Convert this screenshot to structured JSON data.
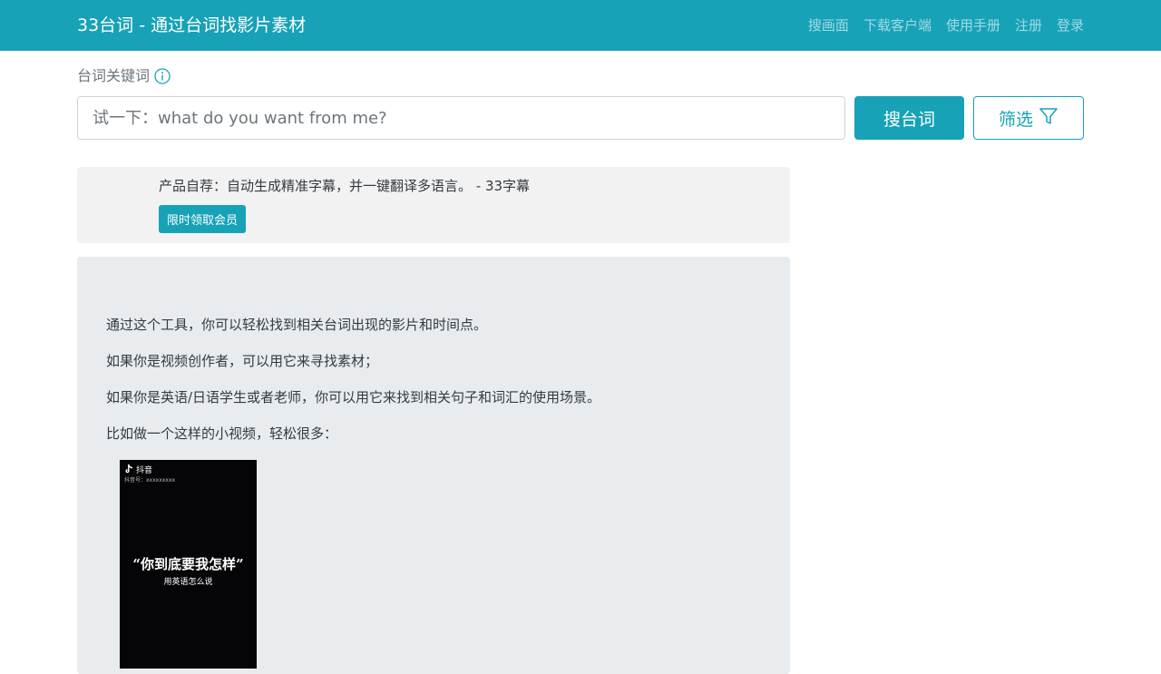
{
  "nav": {
    "brand": "33台词 - 通过台词找影片素材",
    "links": [
      "搜画面",
      "下载客户端",
      "使用手册",
      "注册",
      "登录"
    ]
  },
  "search": {
    "label": "台词关键词",
    "placeholder": "试一下：what do you want from me?",
    "value": "",
    "submit_label": "搜台词",
    "filter_label": "筛选"
  },
  "promo": {
    "text": "产品自荐：自动生成精准字幕，并一键翻译多语言。 - 33字幕",
    "button_label": "限时领取会员"
  },
  "intro": {
    "lines": [
      "通过这个工具，你可以轻松找到相关台词出现的影片和时间点。",
      "如果你是视频创作者，可以用它来寻找素材；",
      "如果你是英语/日语学生或者老师，你可以用它来找到相关句子和词汇的使用场景。",
      "比如做一个这样的小视频，轻松很多："
    ],
    "video": {
      "platform": "抖音",
      "account_id": "抖音号：xxxxxxxxx",
      "quote": "“你到底要我怎样”",
      "subtitle": "用英语怎么说"
    }
  },
  "colors": {
    "primary": "#17a2b8",
    "promo_bg": "#f2f2f2",
    "intro_bg": "#e8ecef"
  }
}
